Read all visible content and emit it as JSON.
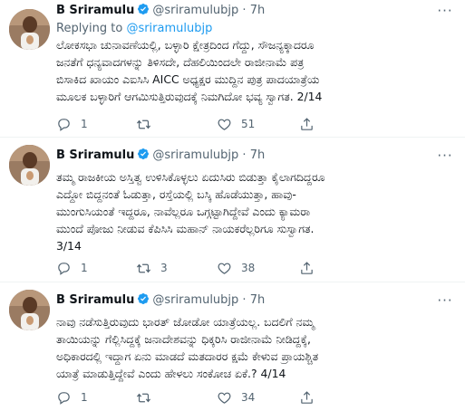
{
  "tweets": [
    {
      "author": {
        "name": "B Sriramulu",
        "handle": "@sriramulubjp"
      },
      "time": "7h",
      "replying": {
        "prefix": "Replying to",
        "mention": "@sriramulubjp"
      },
      "lines": [
        "ಲೋಕಸಭಾ ಚುನಾವಣೆಯಲ್ಲಿ, ಬಳ್ಳಾರಿ ಕ್ಷೇತ್ರದಿಂದ ಗೆದ್ದು, ಸೌಜನ್ಯಕ್ಕಾದರೂ",
        "ಜನತೆಗೆ ಧನ್ಯವಾದಗಳನ್ನು ತಿಳಿಸದೇ, ದೆಹಲಿಯಿಂದಲೇ ರಾಜೀನಾಮೆ ಪತ್ರ",
        "ಬಿಸಾಕಿದ ಖಾಯಂ ಎಐಸಿಸಿ AICC ಅಧ್ಯಕ್ಷರ ಮುದ್ದಿನ ಪುತ್ರ ಪಾದಯಾತ್ರೆಯ",
        "ಮೂಲಕ ಬಳ್ಳಾರಿಗೆ ಆಗಮಿಸುತ್ತಿರುವುದಕ್ಕೆ ನಿಮಗಿದೋ ಭವ್ಯ ಸ್ವಾಗತ. 2/14"
      ],
      "stats": {
        "replies": "1",
        "retweets": "",
        "likes": "51"
      }
    },
    {
      "author": {
        "name": "B Sriramulu",
        "handle": "@sriramulubjp"
      },
      "time": "7h",
      "lines": [
        "ತಮ್ಮ ರಾಜಕೀಯ ಅಸ್ತಿತ್ವ ಉಳಿಸಿಕೊಳ್ಳಲು ಏದುಸಿರು ಬಿಡುತ್ತಾ ಕೈಲಾಗದಿದ್ದರೂ",
        "ಎದ್ದೋ ಬಿದ್ದನಂತೆ ಓಡುತ್ತಾ, ರಸ್ತೆಯಲ್ಲಿ ಬಸ್ಕಿ ಹೊಡೆಯುತ್ತಾ, ಹಾವು-",
        "ಮುಂಗುಸಿಯಂತೆ ಇದ್ದರೂ, ನಾವೆಲ್ಲರೂ ಒಗ್ಗಟ್ಟಾಗಿದ್ದೇವೆ ಎಂದು ಕ್ಯಾಮರಾ",
        "ಮುಂದೆ ಪೋಜು ನೀಡುವ ಕೆಪಿಸಿಸಿ ಮಹಾನ್ ನಾಯಕರೆಲ್ಲರಿಗೂ ಸುಸ್ವಾಗತ.",
        "3/14"
      ],
      "stats": {
        "replies": "1",
        "retweets": "3",
        "likes": "38"
      }
    },
    {
      "author": {
        "name": "B Sriramulu",
        "handle": "@sriramulubjp"
      },
      "time": "7h",
      "lines": [
        "ನಾವು ನಡೆಸುತ್ತಿರುವುದು ಭಾರತ್ ಜೋಡೋ ಯಾತ್ರೆಯಲ್ಲ. ಬದಲಿಗೆ ನಮ್ಮ",
        "ತಾಯಿಯನ್ನು ಗೆಲ್ಲಿಸಿದ್ದಕ್ಕೆ ಜನಾದೇಶವನ್ನು ಧಿಕ್ಕರಿಸಿ ರಾಜೀನಾಮೆ ನೀಡಿದ್ದಕ್ಕೆ,",
        "ಅಧಿಕಾರದಲ್ಲಿ ಇದ್ದಾಗ ಏನು ಮಾಡದೆ ಮತದಾರರ ಕ್ಷಮೆ ಕೇಳುವ ಪ್ರಾಯಶ್ಚಿತ",
        "ಯಾತ್ರೆ ಮಾಡುತ್ತಿದ್ದೇವೆ ಎಂದು ಹೇಳಲು ಸಂಕೋಚ ಏಕೆ.? 4/14"
      ],
      "stats": {
        "replies": "1",
        "retweets": "",
        "likes": "34"
      }
    }
  ],
  "colors": {
    "accent": "#1d9bf0",
    "muted": "#536471",
    "text": "#0f1419",
    "divider": "#eff3f4"
  },
  "icons": [
    "verified-badge-icon",
    "more-icon",
    "reply-icon",
    "retweet-icon",
    "like-icon",
    "share-icon"
  ]
}
